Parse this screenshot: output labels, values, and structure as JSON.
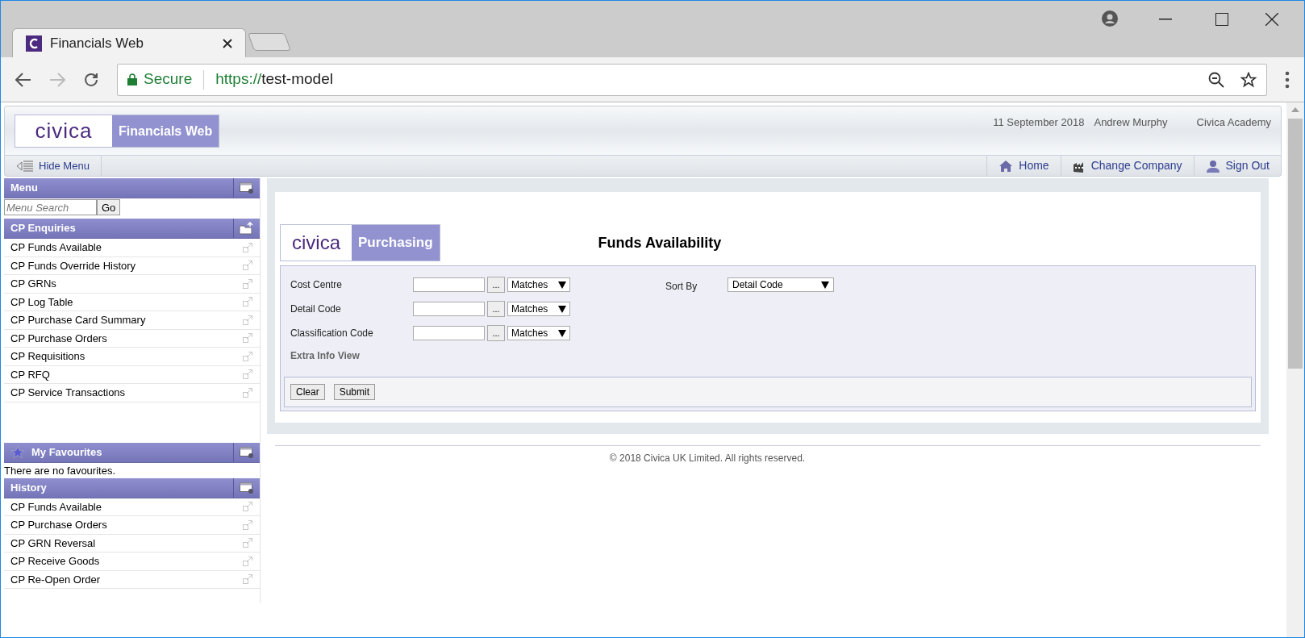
{
  "browser": {
    "tab_title": "Financials Web",
    "secure_label": "Secure",
    "url_scheme": "https://",
    "url_host": "test-model"
  },
  "header": {
    "logo": "civica",
    "product": "Financials Web",
    "date": "11 September 2018",
    "user": "Andrew Murphy",
    "company": "Civica Academy"
  },
  "navbar": {
    "hide_menu": "Hide Menu",
    "links": [
      {
        "kind": "home",
        "label": "Home"
      },
      {
        "kind": "company",
        "label": "Change Company"
      },
      {
        "kind": "signout",
        "label": "Sign Out"
      }
    ]
  },
  "sidebar": {
    "menu_title": "Menu",
    "search_placeholder": "Menu Search",
    "go": "Go",
    "sections": [
      {
        "title": "CP Enquiries",
        "items": [
          "CP Funds Available",
          "CP Funds Override History",
          "CP GRNs",
          "CP Log Table",
          "CP Purchase Card Summary",
          "CP Purchase Orders",
          "CP Requisitions",
          "CP RFQ",
          "CP Service Transactions"
        ]
      }
    ],
    "favourites_title": "My Favourites",
    "favourites_empty": "There are no favourites.",
    "history_title": "History",
    "history": [
      "CP Funds Available",
      "CP Purchase Orders",
      "CP GRN Reversal",
      "CP Receive Goods",
      "CP Re-Open Order"
    ]
  },
  "form": {
    "logo": "civica",
    "module": "Purchasing",
    "title": "Funds Availability",
    "fields": [
      {
        "label": "Cost Centre",
        "lookup": "...",
        "operator": "Matches"
      },
      {
        "label": "Detail Code",
        "lookup": "...",
        "operator": "Matches"
      },
      {
        "label": "Classification Code",
        "lookup": "...",
        "operator": "Matches"
      }
    ],
    "sort_label": "Sort By",
    "sort_value": "Detail Code",
    "extra_info": "Extra Info View",
    "buttons": [
      "Clear",
      "Submit"
    ]
  },
  "footer": "© 2018 Civica UK Limited. All rights reserved."
}
